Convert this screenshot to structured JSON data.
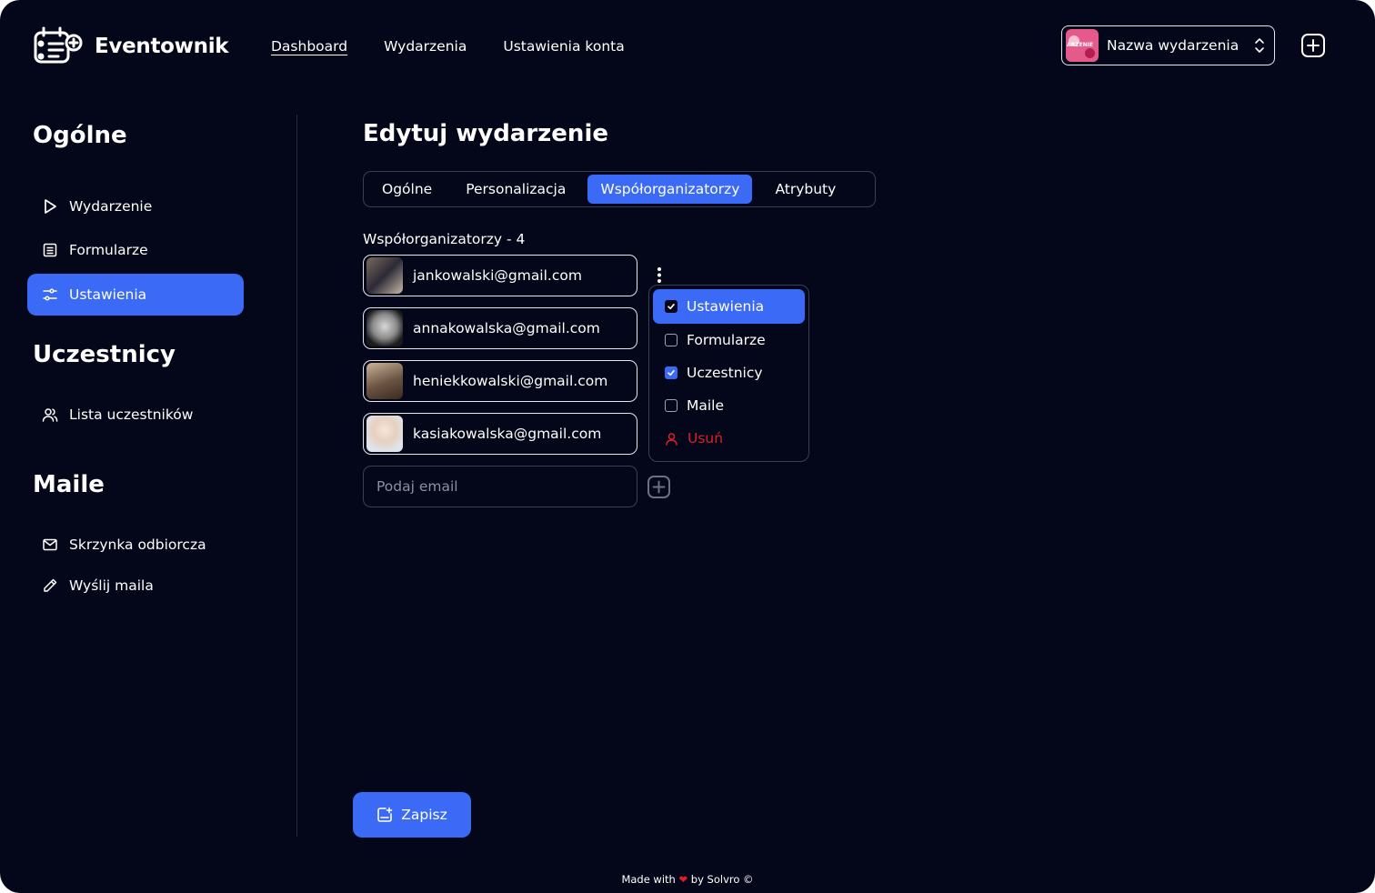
{
  "app": {
    "name": "Eventownik"
  },
  "topnav": [
    {
      "label": "Dashboard",
      "active": true
    },
    {
      "label": "Wydarzenia",
      "active": false
    },
    {
      "label": "Ustawienia konta",
      "active": false
    }
  ],
  "event_selector": {
    "thumb_text": "ARZENIE",
    "name": "Nazwa wydarzenia"
  },
  "sidebar": {
    "sections": [
      {
        "title": "Ogólne",
        "items": [
          {
            "label": "Wydarzenie",
            "icon": "play-icon"
          },
          {
            "label": "Formularze",
            "icon": "form-icon"
          },
          {
            "label": "Ustawienia",
            "icon": "sliders-icon",
            "active": true
          }
        ]
      },
      {
        "title": "Uczestnicy",
        "items": [
          {
            "label": "Lista uczestników",
            "icon": "users-icon"
          }
        ]
      },
      {
        "title": "Maile",
        "items": [
          {
            "label": "Skrzynka odbiorcza",
            "icon": "mail-icon"
          },
          {
            "label": "Wyślij maila",
            "icon": "pencil-icon"
          }
        ]
      }
    ]
  },
  "main": {
    "title": "Edytuj wydarzenie",
    "tabs": [
      {
        "label": "Ogólne"
      },
      {
        "label": "Personalizacja"
      },
      {
        "label": "Współorganizatorzy",
        "active": true
      },
      {
        "label": "Atrybuty"
      }
    ],
    "coorganizers_label": "Współorganizatorzy - 4",
    "coorganizers": [
      {
        "email": "jankowalski@gmail.com"
      },
      {
        "email": "annakowalska@gmail.com"
      },
      {
        "email": "heniekkowalski@gmail.com"
      },
      {
        "email": "kasiakowalska@gmail.com"
      }
    ],
    "permissions_menu": [
      {
        "label": "Ustawienia",
        "checked": true
      },
      {
        "label": "Formularze",
        "checked": false
      },
      {
        "label": "Uczestnicy",
        "checked": true
      },
      {
        "label": "Maile",
        "checked": false
      }
    ],
    "remove_label": "Usuń",
    "email_placeholder": "Podaj email",
    "save_label": "Zapisz"
  },
  "footer": {
    "prefix": "Made with",
    "suffix": "by Solvro ©"
  },
  "colors": {
    "background": "#040719",
    "accent": "#3b6bf6",
    "danger": "#e11d2a",
    "heart": "#e11d2a"
  }
}
